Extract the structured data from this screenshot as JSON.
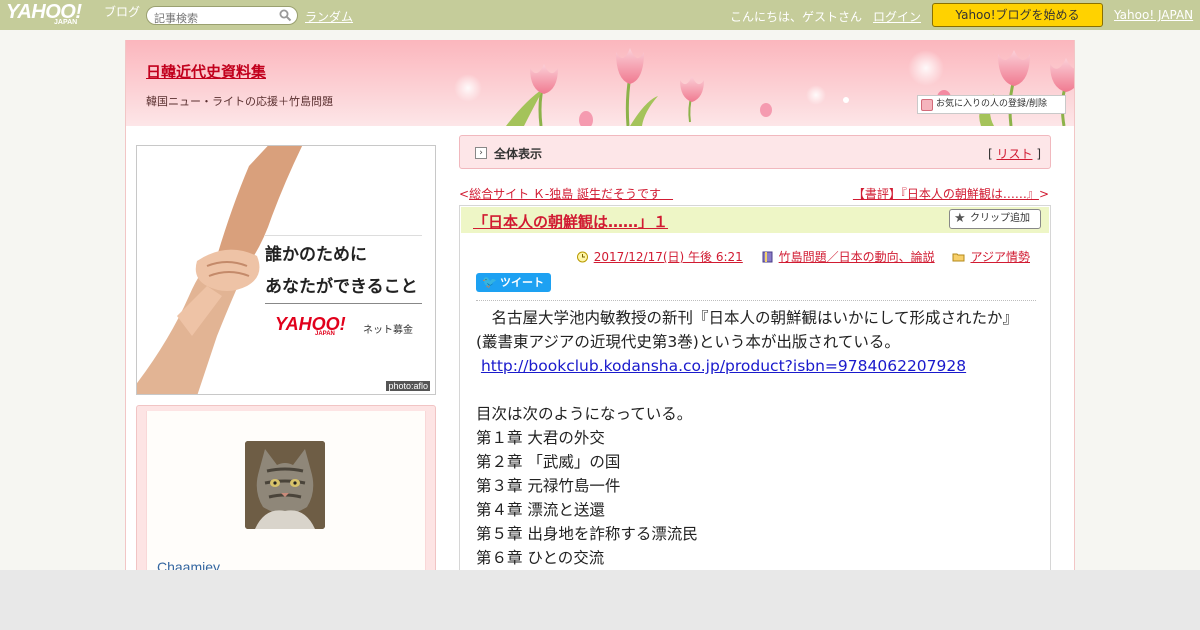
{
  "topbar": {
    "logo_yahoo": "YAHOO!",
    "logo_japan": "JAPAN",
    "logo_blog": "ブログ",
    "search_placeholder": "記事検索",
    "random_link": "ランダム",
    "greeting": "こんにちは、ゲストさん",
    "login_link": "ログイン",
    "start_button": "Yahoo!ブログを始める",
    "yahoo_japan_link": "Yahoo! JAPAN"
  },
  "header": {
    "blog_title": "日韓近代史資料集",
    "blog_subtitle": "韓国ニュー・ライトの応援＋竹島問題",
    "favorite_button": "お気に入りの人の登録/削除"
  },
  "sidebar": {
    "banner": {
      "line1": "誰かのために",
      "line2": "あなたができること",
      "logo_yahoo": "YAHOO!",
      "logo_japan": "JAPAN",
      "service": "ネット募金",
      "credit": "photo:aflo"
    },
    "profile": {
      "name": "Chaamiey"
    }
  },
  "main": {
    "view_label": "全体表示",
    "list_bracket_open": "[",
    "list_link": "リスト",
    "list_bracket_close": "]",
    "prev_arrow": "<",
    "prev_link": "総合サイト Ｋ-独島 誕生だそうです　",
    "next_link": "【書評】『日本人の朝鮮観は‥‥‥』",
    "next_arrow": ">",
    "article": {
      "title": "「日本人の朝鮮観は‥‥‥」１",
      "clip_button": "クリップ追加",
      "date": "2017/12/17(日) 午後 6:21",
      "category": "竹島問題／日本の動向、論説",
      "folder": "アジア情勢",
      "tweet_button": "ツイート",
      "body": [
        "　名古屋大学池内敏教授の新刊『日本人の朝鮮観はいかにして形成されたか』",
        "(叢書東アジアの近現代史第3巻)という本が出版されている。",
        "",
        "",
        "目次は次のようになっている。",
        "第１章 大君の外交",
        "第２章 「武威」の国",
        "第３章 元禄竹島一件",
        "第４章 漂流と送還",
        "第５章 出身地を詐称する漂流民",
        "第６章 ひとの交流"
      ],
      "link": "http://bookclub.kodansha.co.jp/product?isbn=9784062207928"
    }
  }
}
